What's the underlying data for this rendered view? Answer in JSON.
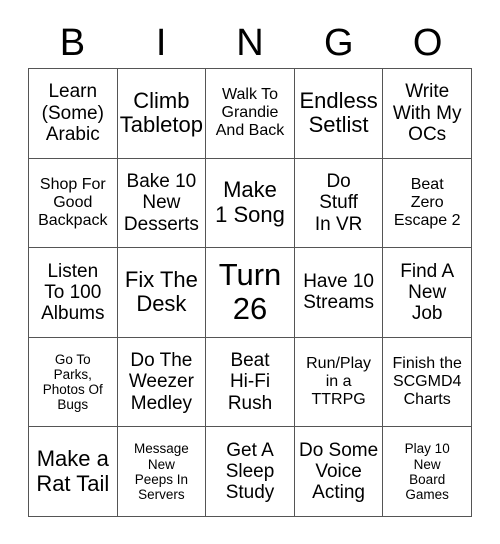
{
  "card": {
    "header": {
      "letters": [
        "B",
        "I",
        "N",
        "G",
        "O"
      ]
    },
    "columns": [
      "B",
      "I",
      "N",
      "G",
      "O"
    ],
    "rows": [
      [
        {
          "text": "Learn\n(Some)\nArabic",
          "size": "fs-md"
        },
        {
          "text": "Climb\nTabletop",
          "size": "fs-lg"
        },
        {
          "text": "Walk To\nGrandie\nAnd Back",
          "size": "fs-sm"
        },
        {
          "text": "Endless\nSetlist",
          "size": "fs-lg"
        },
        {
          "text": "Write\nWith My\nOCs",
          "size": "fs-md"
        }
      ],
      [
        {
          "text": "Shop For\nGood\nBackpack",
          "size": "fs-sm"
        },
        {
          "text": "Bake 10\nNew\nDesserts",
          "size": "fs-md"
        },
        {
          "text": "Make\n1 Song",
          "size": "fs-lg"
        },
        {
          "text": "Do\nStuff\nIn VR",
          "size": "fs-md"
        },
        {
          "text": "Beat\nZero\nEscape 2",
          "size": "fs-sm"
        }
      ],
      [
        {
          "text": "Listen\nTo 100\nAlbums",
          "size": "fs-md"
        },
        {
          "text": "Fix The\nDesk",
          "size": "fs-lg"
        },
        {
          "text": "Turn\n26",
          "size": "fs-xl"
        },
        {
          "text": "Have 10\nStreams",
          "size": "fs-md"
        },
        {
          "text": "Find A\nNew\nJob",
          "size": "fs-md"
        }
      ],
      [
        {
          "text": "Go To\nParks,\nPhotos Of\nBugs",
          "size": "fs-xs"
        },
        {
          "text": "Do The\nWeezer\nMedley",
          "size": "fs-md"
        },
        {
          "text": "Beat\nHi-Fi\nRush",
          "size": "fs-md"
        },
        {
          "text": "Run/Play\nin a\nTTRPG",
          "size": "fs-sm"
        },
        {
          "text": "Finish the\nSCGMD4\nCharts",
          "size": "fs-sm"
        }
      ],
      [
        {
          "text": "Make a\nRat Tail",
          "size": "fs-lg"
        },
        {
          "text": "Message\nNew\nPeeps In\nServers",
          "size": "fs-xs"
        },
        {
          "text": "Get A\nSleep\nStudy",
          "size": "fs-md"
        },
        {
          "text": "Do Some\nVoice\nActing",
          "size": "fs-md"
        },
        {
          "text": "Play 10\nNew\nBoard\nGames",
          "size": "fs-xs"
        }
      ]
    ]
  },
  "colors": {
    "background": "#ffffff",
    "text": "#000000",
    "border": "#555555"
  }
}
